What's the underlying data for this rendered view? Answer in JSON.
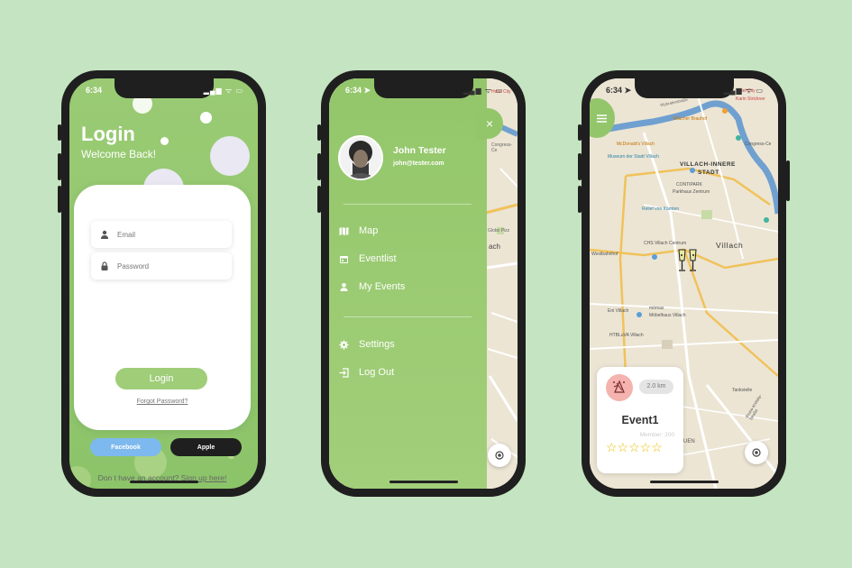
{
  "status": {
    "time": "6:34",
    "icons": "▂▄▆ ᯤ ▭",
    "time_arrow": "6:34 ➤"
  },
  "login": {
    "title": "Login",
    "subtitle": "Welcome Back!",
    "email_placeholder": "Email",
    "password_placeholder": "Password",
    "login_button": "Login",
    "forgot": "Forgot Password?",
    "facebook": "Facebook",
    "apple": "Apple",
    "no_account": "Don t have an account? ",
    "signup": "Sign up here!"
  },
  "drawer": {
    "close": "×",
    "user_name": "John Tester",
    "user_email": "john@tester.com",
    "menu": [
      {
        "label": "Map",
        "icon": "map-icon"
      },
      {
        "label": "Eventlist",
        "icon": "calendar-icon"
      },
      {
        "label": "My Events",
        "icon": "person-icon"
      }
    ],
    "menu2": [
      {
        "label": "Settings",
        "icon": "gear-icon"
      },
      {
        "label": "Log Out",
        "icon": "logout-icon"
      }
    ]
  },
  "map": {
    "labels": [
      "Wybraterstraße",
      "Villacher Brauhof",
      "McDonald's Villach",
      "Museum der Stadt Villach",
      "Congress-Ce",
      "VILLACH-INNERE",
      "STADT",
      "CONTIPARK",
      "Parkhaus Zentrum",
      "Relief von Kärnten",
      "Villach",
      "CHS Villach Centrum",
      "Westbahnhof",
      "Eni Villach",
      "mömax",
      "Möbelhaus Villach",
      "HTBLuVA Villach",
      "Tankstelle",
      "Hotel City",
      "Karin Strickner",
      "Globo Pizz",
      "ach",
      "Bruno-Kreisky-Straße",
      "UEN",
      "Infi"
    ]
  },
  "event": {
    "distance": "2.0 km",
    "name": "Event1",
    "members": "Member: 200",
    "stars": "☆☆☆☆☆",
    "rating": 0
  },
  "colors": {
    "accent": "#93c66a",
    "background": "#c5e4c1",
    "facebook": "#7db9ee",
    "apple": "#1f1f1f",
    "river": "#6fa0d0"
  }
}
